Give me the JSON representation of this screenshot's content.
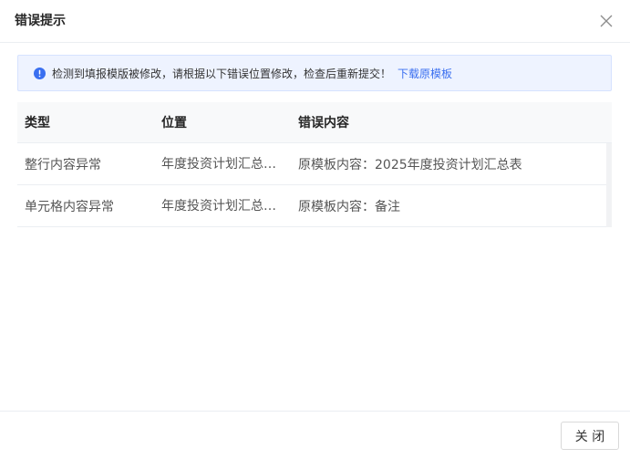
{
  "dialog": {
    "title": "错误提示",
    "close_icon": "close-icon"
  },
  "alert": {
    "icon": "exclamation-circle-icon",
    "icon_color": "#3a6ff0",
    "message": "检测到填报模版被修改，请根据以下错误位置修改，检查后重新提交！",
    "link": "下载原模板",
    "link_color": "#3a6ff0"
  },
  "table": {
    "headers": [
      "类型",
      "位置",
      "错误内容"
    ],
    "rows": [
      [
        "整行内容异常",
        "年度投资计划汇总…",
        "原模板内容：2025年度投资计划汇总表"
      ],
      [
        "单元格内容异常",
        "年度投资计划汇总…",
        "原模板内容：备注"
      ]
    ]
  },
  "footer": {
    "close_label": "关 闭"
  }
}
